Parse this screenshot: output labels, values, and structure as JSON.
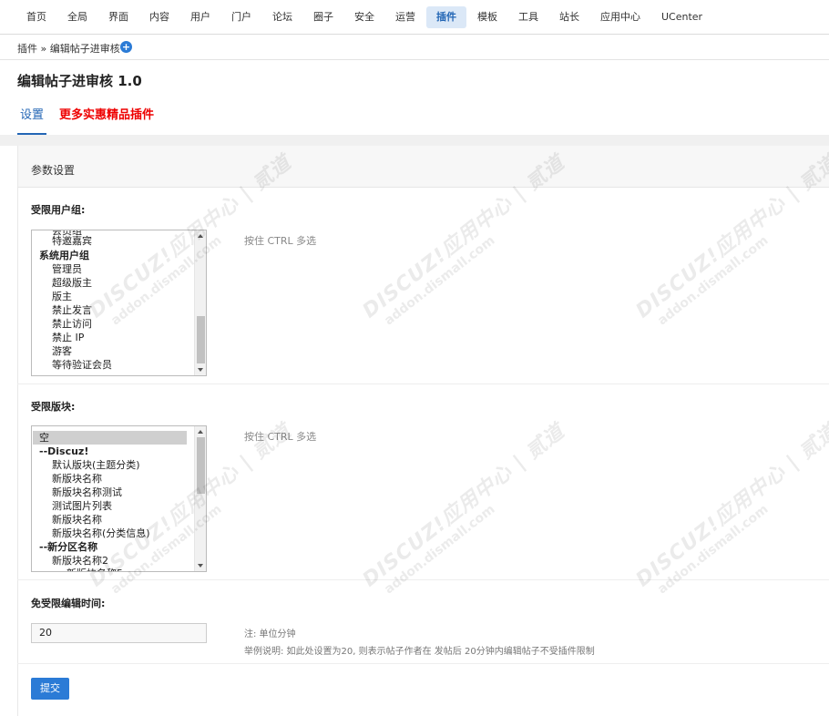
{
  "nav": {
    "items": [
      "首页",
      "全局",
      "界面",
      "内容",
      "用户",
      "门户",
      "论坛",
      "圈子",
      "安全",
      "运营",
      "插件",
      "模板",
      "工具",
      "站长",
      "应用中心",
      "UCenter"
    ],
    "active_index": 10
  },
  "breadcrumb": "插件 » 编辑帖子进审核",
  "page_title": "编辑帖子进审核 1.0",
  "tabs": {
    "settings": "设置",
    "more_plugins": "更多实惠精品插件"
  },
  "section_title": "参数设置",
  "user_groups": {
    "label": "受限用户组:",
    "hint": "按住 CTRL 多选",
    "options": [
      "特邀嘉宾",
      "系统用户组",
      "管理员",
      "超级版主",
      "版主",
      "禁止发言",
      "禁止访问",
      "禁止 IP",
      "游客",
      "等待验证会员"
    ]
  },
  "forums": {
    "label": "受限版块:",
    "hint": "按住 CTRL 多选",
    "options": [
      "空",
      "--Discuz!",
      "默认版块(主题分类)",
      "新版块名称",
      "新版块名称测试",
      "测试图片列表",
      "新版块名称",
      "新版块名称(分类信息)",
      "--新分区名称",
      "新版块名称2"
    ],
    "selected_index": 0
  },
  "edit_time": {
    "label": "免受限编辑时间:",
    "value": "20",
    "note_unit": "注: 单位分钟",
    "note_example": "举例说明: 如此处设置为20, 则表示帖子作者在 发帖后 20分钟内编辑帖子不受插件限制"
  },
  "submit_label": "提交",
  "watermark": {
    "brand": "DISCUZ!应用中心 | 贰道",
    "url": "addon.dismall.com"
  },
  "colors": {
    "accent": "#2b7bd6",
    "promo": "#ee0000",
    "active_nav_bg": "#dbe8f7"
  }
}
